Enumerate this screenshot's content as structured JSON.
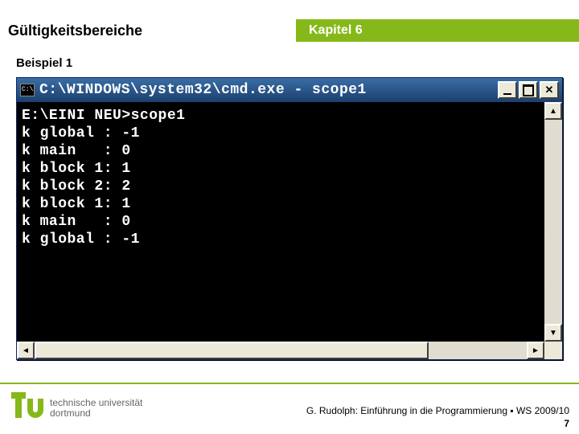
{
  "header": {
    "left": "Gültigkeitsbereiche",
    "right": "Kapitel 6"
  },
  "subtitle": "Beispiel 1",
  "console": {
    "title": "C:\\WINDOWS\\system32\\cmd.exe - scope1",
    "lines": [
      "E:\\EINI NEU>scope1",
      "k global : -1",
      "k main   : 0",
      "k block 1: 1",
      "k block 2: 2",
      "k block 1: 1",
      "k main   : 0",
      "k global : -1"
    ],
    "icons": {
      "minimize": "minimize-icon",
      "maximize": "maximize-icon",
      "close": "close-icon",
      "arrow_up": "▲",
      "arrow_down": "▼",
      "arrow_left": "◄",
      "arrow_right": "►"
    }
  },
  "footer": {
    "uni_line1": "technische universität",
    "uni_line2": "dortmund",
    "credit_main": "G. Rudolph: Einführung in die Programmierung ▪ WS 2009/10",
    "slide_number": "7"
  },
  "colors": {
    "accent": "#86b81a",
    "titlebar": "#1c3f6e"
  }
}
